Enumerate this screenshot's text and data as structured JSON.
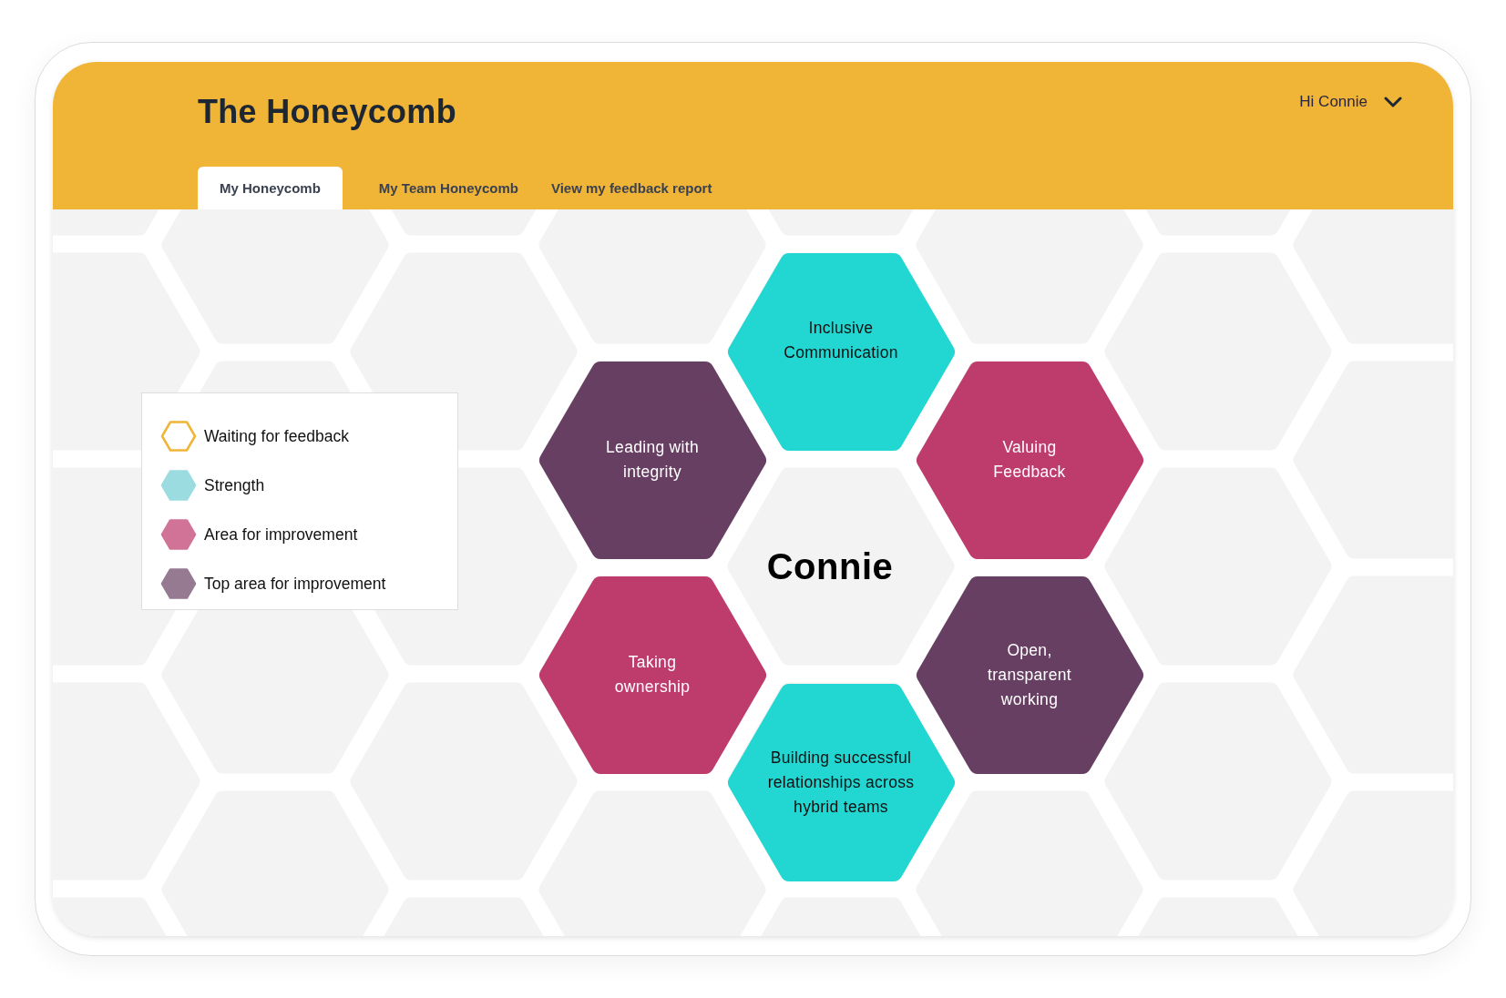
{
  "header": {
    "title": "The Honeycomb",
    "greeting": "Hi Connie"
  },
  "tabs": [
    {
      "label": "My Honeycomb",
      "selected": true
    },
    {
      "label": "My Team Honeycomb",
      "selected": false
    },
    {
      "label": "View my feedback report",
      "selected": false
    }
  ],
  "legend": [
    {
      "kind": "waiting",
      "label": "Waiting for feedback"
    },
    {
      "kind": "strength",
      "label": "Strength"
    },
    {
      "kind": "improvement",
      "label": "Area for improvement"
    },
    {
      "kind": "top_improvement",
      "label": "Top area for improvement"
    }
  ],
  "honeycomb": {
    "center": "Connie",
    "cells": [
      {
        "label": "Inclusive\nCommunication",
        "color": "#22d6d2"
      },
      {
        "label": "Leading with\nintegrity",
        "color": "#673f62"
      },
      {
        "label": "Valuing\nFeedback",
        "color": "#be3c6c"
      },
      {
        "label": "Taking\nownership",
        "color": "#be3c6c"
      },
      {
        "label": "Open,\ntransparent\nworking",
        "color": "#673f62"
      },
      {
        "label": "Building successful\nrelationships across\nhybrid teams",
        "color": "#22d6d2"
      }
    ]
  }
}
